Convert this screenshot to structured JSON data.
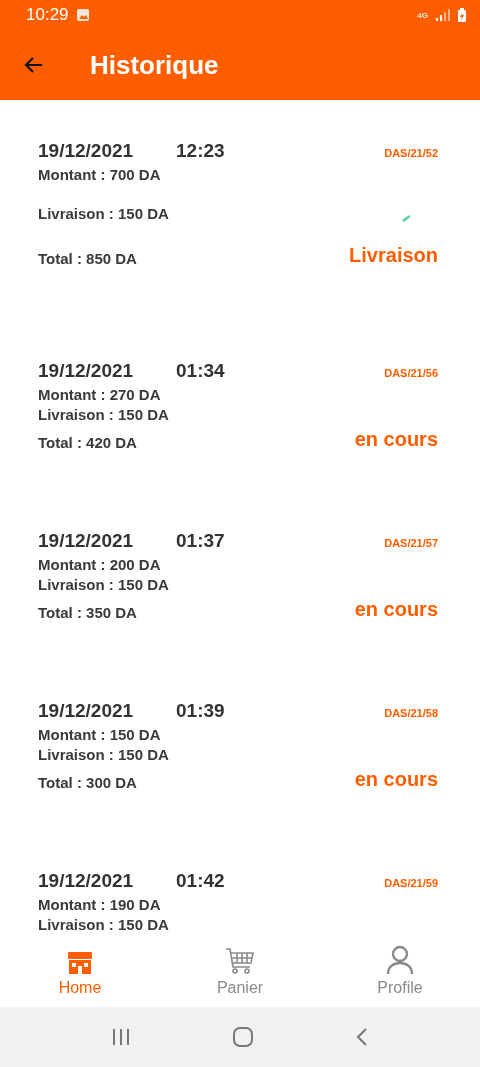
{
  "status_bar": {
    "time": "10:29",
    "network": "4G"
  },
  "app_bar": {
    "title": "Historique"
  },
  "orders": [
    {
      "kind": "spaced",
      "date": "19/12/2021",
      "time": "12:23",
      "reference": "DAS/21/52",
      "amount": "Montant : 700 DA",
      "delivery": "Livraison : 150 DA",
      "total": "Total : 850 DA",
      "status": "Livraison"
    },
    {
      "kind": "compact",
      "date": "19/12/2021",
      "time": "01:34",
      "reference": "DAS/21/56",
      "amount": "Montant : 270 DA",
      "delivery": "Livraison : 150 DA",
      "total": "Total : 420 DA",
      "status": "en cours"
    },
    {
      "kind": "compact",
      "date": "19/12/2021",
      "time": "01:37",
      "reference": "DAS/21/57",
      "amount": "Montant : 200 DA",
      "delivery": "Livraison : 150 DA",
      "total": "Total : 350 DA",
      "status": "en cours"
    },
    {
      "kind": "compact",
      "date": "19/12/2021",
      "time": "01:39",
      "reference": "DAS/21/58",
      "amount": "Montant : 150 DA",
      "delivery": "Livraison : 150 DA",
      "total": "Total : 300 DA",
      "status": "en cours"
    },
    {
      "kind": "compact",
      "date": "19/12/2021",
      "time": "01:42",
      "reference": "DAS/21/59",
      "amount": "Montant : 190 DA",
      "delivery": "Livraison : 150 DA"
    }
  ],
  "bottom_nav": [
    {
      "kind": "home",
      "label": "Home",
      "selected": true
    },
    {
      "kind": "cart",
      "label": "Panier",
      "selected": false
    },
    {
      "kind": "profile",
      "label": "Profile",
      "selected": false
    }
  ]
}
